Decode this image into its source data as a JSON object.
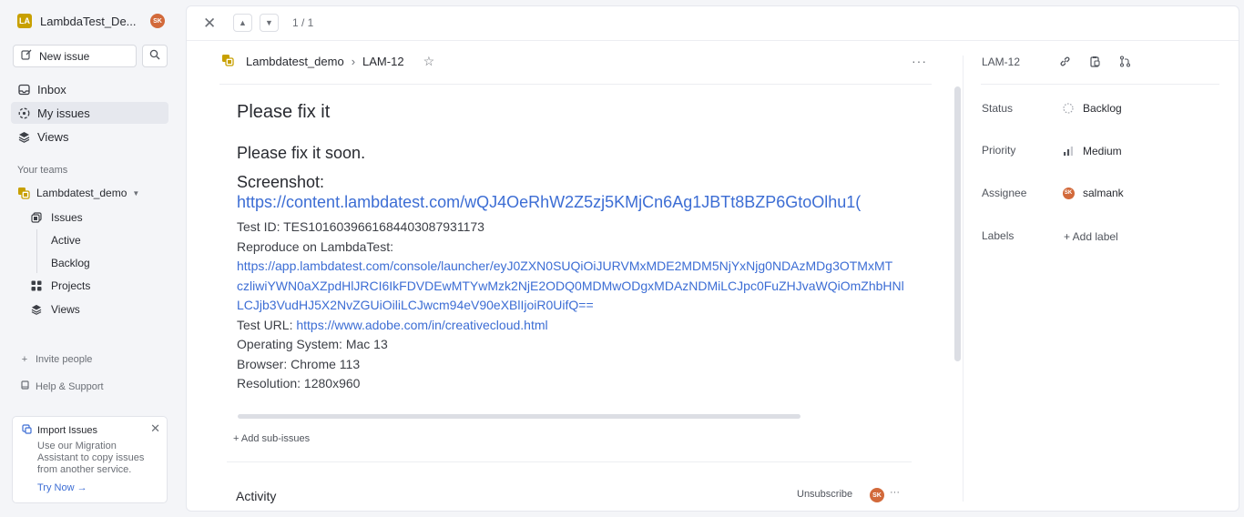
{
  "workspace": {
    "initials": "LA",
    "name": "LambdaTest_De...",
    "user_initials": "SK"
  },
  "sidebar": {
    "new_issue_label": "New issue",
    "nav": [
      {
        "label": "Inbox"
      },
      {
        "label": "My issues"
      },
      {
        "label": "Views"
      }
    ],
    "teams_label": "Your teams",
    "team": {
      "name": "Lambdatest_demo",
      "items": [
        {
          "label": "Issues"
        },
        {
          "label": "Active"
        },
        {
          "label": "Backlog"
        },
        {
          "label": "Projects"
        },
        {
          "label": "Views"
        }
      ]
    },
    "invite_label": "Invite people",
    "help_label": "Help & Support",
    "import": {
      "title": "Import Issues",
      "text": "Use our Migration Assistant to copy issues from another service.",
      "link": "Try Now →"
    }
  },
  "topbar": {
    "pager": "1 / 1"
  },
  "breadcrumb": {
    "team": "Lambdatest_demo",
    "sep": "›",
    "issue_id": "LAM-12"
  },
  "issue": {
    "title": "Please fix it",
    "description": "Please fix it soon.",
    "screenshot_label": "Screenshot:",
    "screenshot_url": "https://content.lambdatest.com/wQJ4OeRhW2Z5zj5KMjCn6Ag1JBTt8BZP6GtoOlhu1(",
    "test_id": "Test ID: TES10160396616844030879311​73",
    "reproduce_label": "Reproduce on LambdaTest:",
    "reproduce_lines": [
      "https://app.lambdatest.com/console/launcher/eyJ0ZXN0SUQiOiJURVMxMDE2MDM5NjYxNjg0NDAzMDg3OTMxMT",
      "czliwiYWN0aXZpdHlJRCI6IkFDVDEwMTYwMzk2NjE2ODQ0MDMwODgxMDAzNDMiLCJpc0FuZHJvaWQiOmZhbHNl",
      "LCJjb3VudHJ5X2NvZGUiOiliLCJwcm94eV90eXBlIjoiR0UifQ=="
    ],
    "test_url_label": "Test URL:",
    "test_url": "https://www.adobe.com/in/creativecloud.html",
    "os": "Operating System: Mac 13",
    "browser": "Browser: Chrome 113",
    "resolution": "Resolution: 1280x960",
    "add_sub_issues": "+ Add sub-issues"
  },
  "activity": {
    "title": "Activity",
    "unsubscribe": "Unsubscribe",
    "avatar": "SK",
    "more": "···"
  },
  "properties": {
    "id": "LAM-12",
    "status_label": "Status",
    "status_value": "Backlog",
    "priority_label": "Priority",
    "priority_value": "Medium",
    "assignee_label": "Assignee",
    "assignee_value": "salmank",
    "assignee_initials": "SK",
    "labels_label": "Labels",
    "labels_value": "+ Add label"
  },
  "colors": {
    "accent": "#3c6dd4",
    "workspace": "#c8a000",
    "avatar": "#d2693a",
    "active_bg": "#e6e8ee"
  }
}
